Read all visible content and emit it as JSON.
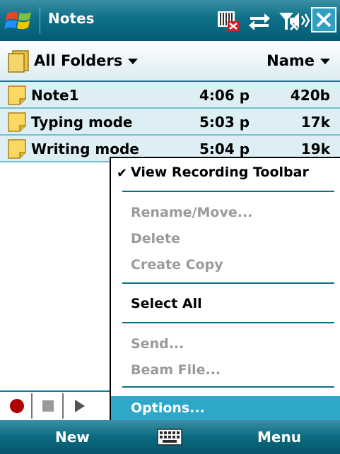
{
  "title_bar": {
    "app_title": "Notes",
    "icons": [
      "windows-start-icon",
      "sim-missing-icon",
      "connectivity-icon",
      "signal-off-icon",
      "speaker-icon",
      "close-icon"
    ]
  },
  "folder_bar": {
    "folder_label": "All Folders",
    "sort_label": "Name"
  },
  "notes": [
    {
      "name": "Note1",
      "time": "4:06 p",
      "size": "420b"
    },
    {
      "name": "Typing mode",
      "time": "5:03 p",
      "size": "17k"
    },
    {
      "name": "Writing mode",
      "time": "5:04 p",
      "size": "19k"
    }
  ],
  "context_menu": {
    "view_recording_toolbar": {
      "label": "View Recording Toolbar",
      "checked": true,
      "enabled": true
    },
    "rename_move": {
      "label": "Rename/Move...",
      "enabled": false
    },
    "delete": {
      "label": "Delete",
      "enabled": false
    },
    "create_copy": {
      "label": "Create Copy",
      "enabled": false
    },
    "select_all": {
      "label": "Select All",
      "enabled": true
    },
    "send": {
      "label": "Send...",
      "enabled": false
    },
    "beam_file": {
      "label": "Beam File...",
      "enabled": false
    },
    "options": {
      "label": "Options...",
      "enabled": true,
      "selected": true
    }
  },
  "recording_toolbar": {
    "buttons": [
      "record-icon",
      "stop-icon",
      "play-icon"
    ]
  },
  "soft_keys": {
    "left": "New",
    "right": "Menu",
    "center_icon": "keyboard-icon"
  },
  "colors": {
    "accent": "#0e7e98",
    "selection": "#2fa7c8",
    "row_background": "#ddeff4",
    "disabled_text": "#9a9a9a",
    "record_red": "#b00000"
  }
}
